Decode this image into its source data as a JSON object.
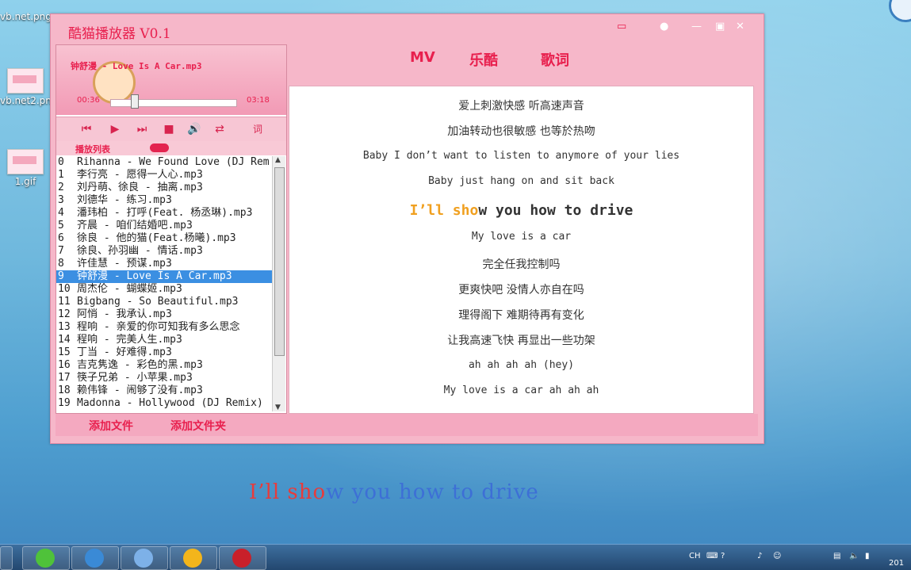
{
  "desktop": {
    "icons": [
      {
        "label": "vb.net.png"
      },
      {
        "label": "vb.net2.png"
      },
      {
        "label": "1.gif"
      }
    ]
  },
  "player": {
    "title": "酷猫播放器 V0.1",
    "now_playing": "钟舒漫 - Love Is A Car.mp3",
    "time_elapsed": "00:36",
    "time_total": "03:18",
    "progress_fraction": 0.18,
    "lyrics_button": "词",
    "playlist_label": "播放列表",
    "playlist": [
      {
        "n": "0",
        "name": "Rihanna - We Found Love (DJ Rem"
      },
      {
        "n": "1",
        "name": "李行亮 - 愿得一人心.mp3"
      },
      {
        "n": "2",
        "name": "刘丹萌、徐良 - 抽离.mp3"
      },
      {
        "n": "3",
        "name": "刘德华 - 练习.mp3"
      },
      {
        "n": "4",
        "name": "潘玮柏 - 打呼(Feat. 杨丞琳).mp3"
      },
      {
        "n": "5",
        "name": "齐晨 - 咱们结婚吧.mp3"
      },
      {
        "n": "6",
        "name": "徐良 - 他的猫(Feat.杨曦).mp3"
      },
      {
        "n": "7",
        "name": "徐良、孙羽幽 - 情话.mp3"
      },
      {
        "n": "8",
        "name": "许佳慧 - 预谋.mp3"
      },
      {
        "n": "9",
        "name": "钟舒漫 - Love Is A Car.mp3"
      },
      {
        "n": "10",
        "name": "周杰伦 - 蝴蝶姬.mp3"
      },
      {
        "n": "11",
        "name": "Bigbang - So Beautiful.mp3"
      },
      {
        "n": "12",
        "name": "阿悄 - 我承认.mp3"
      },
      {
        "n": "13",
        "name": "程响 - 亲爱的你可知我有多么思念"
      },
      {
        "n": "14",
        "name": "程响 - 完美人生.mp3"
      },
      {
        "n": "15",
        "name": "丁当 - 好难得.mp3"
      },
      {
        "n": "16",
        "name": "吉克隽逸 - 彩色的黑.mp3"
      },
      {
        "n": "17",
        "name": "筷子兄弟 - 小苹果.mp3"
      },
      {
        "n": "18",
        "name": "赖伟锋 - 闹够了没有.mp3"
      },
      {
        "n": "19",
        "name": "Madonna - Hollywood (DJ Remix)"
      }
    ],
    "selected_index": 9,
    "tabs": [
      "MV",
      "乐酷",
      "歌词"
    ],
    "lyrics": [
      "爱上刺激快感 听高速声音",
      "加油转动也很敏感 也等於热吻",
      "Baby I don’t want to listen to anymore of your lies",
      "Baby just hang on and sit back",
      "I’ll show you how to drive",
      "My love is a car",
      "完全任我控制吗",
      "更爽快吧 没情人亦自在吗",
      "理得阁下 难期待再有变化",
      "让我高速飞快 再显出一些功架",
      "ah ah ah ah (hey)",
      "My love is a car ah ah ah",
      "☆☆"
    ],
    "current_line_index": 4,
    "current_line_done": "I’ll sho",
    "current_line_rest": "w you how to drive",
    "add_file": "添加文件",
    "add_folder": "添加文件夹"
  },
  "desktop_lyric": {
    "red_part": "I’ll sho",
    "blue_part": "w you how to drive"
  },
  "taskbar": {
    "tray_lang": "CH",
    "clock": "201"
  },
  "colors": {
    "accent": "#e8204e",
    "window_bg": "#f6b7c9",
    "selection": "#3b8fe2",
    "karaoke_done": "#f0a020",
    "desktop_red": "#e83b3b",
    "desktop_blue": "#3d6fd6"
  }
}
